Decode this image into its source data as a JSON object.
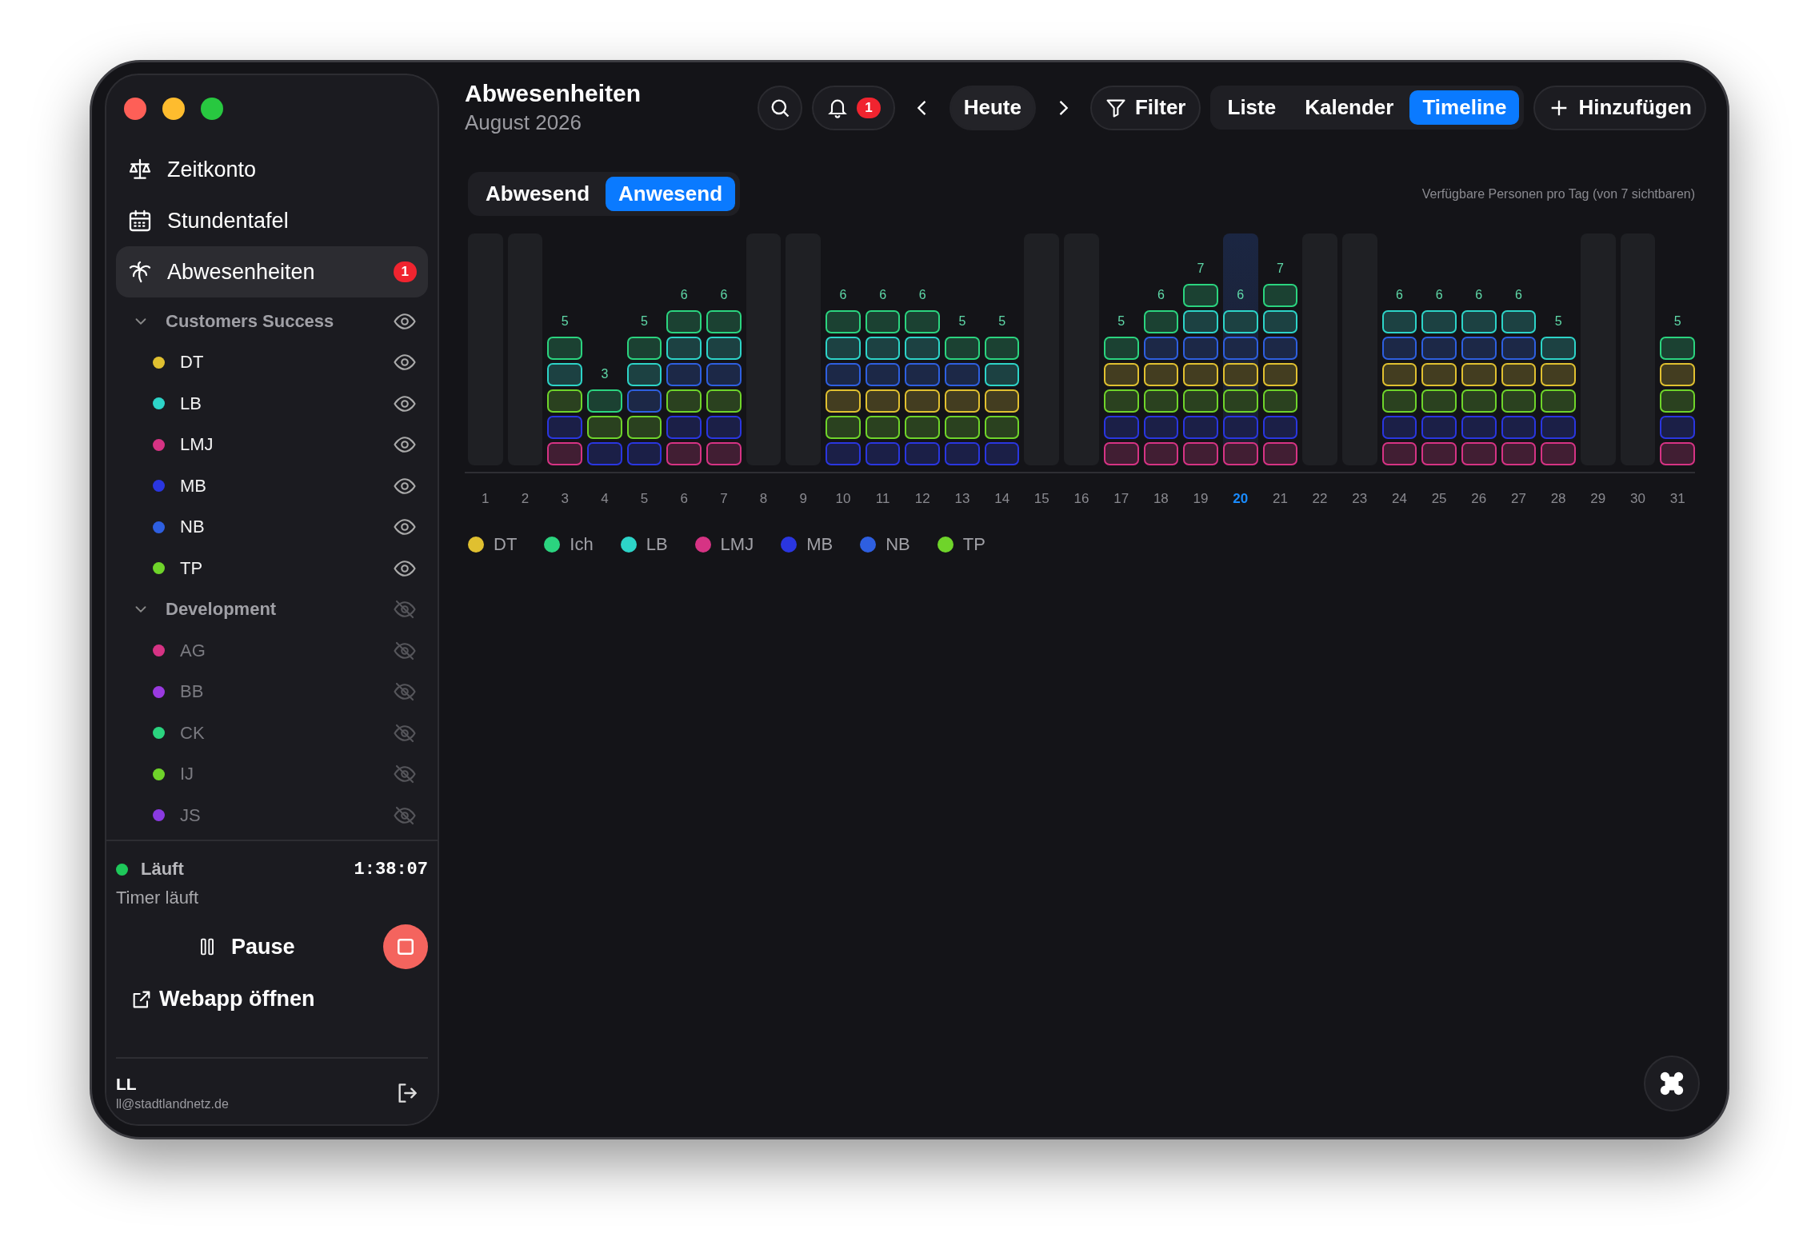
{
  "window": {
    "title": "Abwesenheiten",
    "subtitle": "August 2026"
  },
  "sidebar": {
    "nav": [
      {
        "kind": "scale",
        "label": "Zeitkonto",
        "selected": false
      },
      {
        "kind": "calendar",
        "label": "Stundentafel",
        "selected": false
      },
      {
        "kind": "palm",
        "label": "Abwesenheiten",
        "selected": true,
        "badge": "1"
      }
    ],
    "groups": [
      {
        "label": "Customers Success",
        "expanded": true,
        "visible": true,
        "children": [
          {
            "label": "DT",
            "color": "#e0c030",
            "visible": true
          },
          {
            "label": "LB",
            "color": "#2dd4c8",
            "visible": true
          },
          {
            "label": "LMJ",
            "color": "#d63384",
            "visible": true
          },
          {
            "label": "MB",
            "color": "#2a36e0",
            "visible": true
          },
          {
            "label": "NB",
            "color": "#2e5fe0",
            "visible": true
          },
          {
            "label": "TP",
            "color": "#6fd42a",
            "visible": true
          }
        ]
      },
      {
        "label": "Development",
        "expanded": true,
        "visible": false,
        "children": [
          {
            "label": "AG",
            "color": "#d63384",
            "visible": false
          },
          {
            "label": "BB",
            "color": "#9a3ae0",
            "visible": false
          },
          {
            "label": "CK",
            "color": "#2bd47f",
            "visible": false
          },
          {
            "label": "IJ",
            "color": "#6fd42a",
            "visible": false
          },
          {
            "label": "JS",
            "color": "#8a3ae0",
            "visible": false
          }
        ]
      }
    ],
    "timer": {
      "status": "Läuft",
      "running": true,
      "time": "1:38:07",
      "caption": "Timer läuft",
      "pause": "Pause"
    },
    "webapp": "Webapp öffnen",
    "user": {
      "name": "LL",
      "email": "ll@stadtlandnetz.de"
    }
  },
  "toolbar": {
    "notifications": "1",
    "today": "Heute",
    "filter": "Filter",
    "views": [
      {
        "label": "Liste",
        "selected": false
      },
      {
        "label": "Kalender",
        "selected": false
      },
      {
        "label": "Timeline",
        "selected": true
      }
    ],
    "add": "Hinzufügen"
  },
  "mode_tabs": [
    {
      "label": "Abwesend",
      "selected": false
    },
    {
      "label": "Anwesend",
      "selected": true
    }
  ],
  "caption": "Verfügbare Personen pro Tag (von 7 sichtbaren)",
  "days": [
    {
      "label": "1",
      "kind": "weekend",
      "today": false
    },
    {
      "label": "2",
      "kind": "weekend",
      "today": false
    },
    {
      "label": "3",
      "kind": "workday",
      "today": false,
      "count": "5",
      "blocks": [
        {
          "color": "#d63384"
        },
        {
          "color": "#2a36e0"
        },
        {
          "color": "#6fd42a"
        },
        {
          "color": "#2dd4c8"
        },
        {
          "color": "#2bd47f"
        }
      ]
    },
    {
      "label": "4",
      "kind": "workday",
      "today": false,
      "count": "3",
      "blocks": [
        {
          "color": "#2a36e0"
        },
        {
          "color": "#6fd42a"
        },
        {
          "color": "#2bd47f"
        }
      ]
    },
    {
      "label": "5",
      "kind": "workday",
      "today": false,
      "count": "5",
      "blocks": [
        {
          "color": "#2a36e0"
        },
        {
          "color": "#6fd42a"
        },
        {
          "color": "#2e5fe0"
        },
        {
          "color": "#2dd4c8"
        },
        {
          "color": "#2bd47f"
        }
      ]
    },
    {
      "label": "6",
      "kind": "workday",
      "today": false,
      "count": "6",
      "blocks": [
        {
          "color": "#d63384"
        },
        {
          "color": "#2a36e0"
        },
        {
          "color": "#6fd42a"
        },
        {
          "color": "#2e5fe0"
        },
        {
          "color": "#2dd4c8"
        },
        {
          "color": "#2bd47f"
        }
      ]
    },
    {
      "label": "7",
      "kind": "workday",
      "today": false,
      "count": "6",
      "blocks": [
        {
          "color": "#d63384"
        },
        {
          "color": "#2a36e0"
        },
        {
          "color": "#6fd42a"
        },
        {
          "color": "#2e5fe0"
        },
        {
          "color": "#2dd4c8"
        },
        {
          "color": "#2bd47f"
        }
      ]
    },
    {
      "label": "8",
      "kind": "weekend",
      "today": false
    },
    {
      "label": "9",
      "kind": "weekend",
      "today": false
    },
    {
      "label": "10",
      "kind": "workday",
      "today": false,
      "count": "6",
      "blocks": [
        {
          "color": "#2a36e0"
        },
        {
          "color": "#6fd42a"
        },
        {
          "color": "#e0c030"
        },
        {
          "color": "#2e5fe0"
        },
        {
          "color": "#2dd4c8"
        },
        {
          "color": "#2bd47f"
        }
      ]
    },
    {
      "label": "11",
      "kind": "workday",
      "today": false,
      "count": "6",
      "blocks": [
        {
          "color": "#2a36e0"
        },
        {
          "color": "#6fd42a"
        },
        {
          "color": "#e0c030"
        },
        {
          "color": "#2e5fe0"
        },
        {
          "color": "#2dd4c8"
        },
        {
          "color": "#2bd47f"
        }
      ]
    },
    {
      "label": "12",
      "kind": "workday",
      "today": false,
      "count": "6",
      "blocks": [
        {
          "color": "#2a36e0"
        },
        {
          "color": "#6fd42a"
        },
        {
          "color": "#e0c030"
        },
        {
          "color": "#2e5fe0"
        },
        {
          "color": "#2dd4c8"
        },
        {
          "color": "#2bd47f"
        }
      ]
    },
    {
      "label": "13",
      "kind": "workday",
      "today": false,
      "count": "5",
      "blocks": [
        {
          "color": "#2a36e0"
        },
        {
          "color": "#6fd42a"
        },
        {
          "color": "#e0c030"
        },
        {
          "color": "#2e5fe0"
        },
        {
          "color": "#2bd47f"
        }
      ]
    },
    {
      "label": "14",
      "kind": "workday",
      "today": false,
      "count": "5",
      "blocks": [
        {
          "color": "#2a36e0"
        },
        {
          "color": "#6fd42a"
        },
        {
          "color": "#e0c030"
        },
        {
          "color": "#2dd4c8"
        },
        {
          "color": "#2bd47f"
        }
      ]
    },
    {
      "label": "15",
      "kind": "weekend",
      "today": false
    },
    {
      "label": "16",
      "kind": "weekend",
      "today": false
    },
    {
      "label": "17",
      "kind": "workday",
      "today": false,
      "count": "5",
      "blocks": [
        {
          "color": "#d63384"
        },
        {
          "color": "#2a36e0"
        },
        {
          "color": "#6fd42a"
        },
        {
          "color": "#e0c030"
        },
        {
          "color": "#2bd47f"
        }
      ]
    },
    {
      "label": "18",
      "kind": "workday",
      "today": false,
      "count": "6",
      "blocks": [
        {
          "color": "#d63384"
        },
        {
          "color": "#2a36e0"
        },
        {
          "color": "#6fd42a"
        },
        {
          "color": "#e0c030"
        },
        {
          "color": "#2e5fe0"
        },
        {
          "color": "#2bd47f"
        }
      ]
    },
    {
      "label": "19",
      "kind": "workday",
      "today": false,
      "count": "7",
      "blocks": [
        {
          "color": "#d63384"
        },
        {
          "color": "#2a36e0"
        },
        {
          "color": "#6fd42a"
        },
        {
          "color": "#e0c030"
        },
        {
          "color": "#2e5fe0"
        },
        {
          "color": "#2dd4c8"
        },
        {
          "color": "#2bd47f"
        }
      ]
    },
    {
      "label": "20",
      "kind": "workday",
      "today": true,
      "count": "6",
      "blocks": [
        {
          "color": "#d63384"
        },
        {
          "color": "#2a36e0"
        },
        {
          "color": "#6fd42a"
        },
        {
          "color": "#e0c030"
        },
        {
          "color": "#2e5fe0"
        },
        {
          "color": "#2dd4c8"
        }
      ]
    },
    {
      "label": "21",
      "kind": "workday",
      "today": false,
      "count": "7",
      "blocks": [
        {
          "color": "#d63384"
        },
        {
          "color": "#2a36e0"
        },
        {
          "color": "#6fd42a"
        },
        {
          "color": "#e0c030"
        },
        {
          "color": "#2e5fe0"
        },
        {
          "color": "#2dd4c8"
        },
        {
          "color": "#2bd47f"
        }
      ]
    },
    {
      "label": "22",
      "kind": "weekend",
      "today": false
    },
    {
      "label": "23",
      "kind": "weekend",
      "today": false
    },
    {
      "label": "24",
      "kind": "workday",
      "today": false,
      "count": "6",
      "blocks": [
        {
          "color": "#d63384"
        },
        {
          "color": "#2a36e0"
        },
        {
          "color": "#6fd42a"
        },
        {
          "color": "#e0c030"
        },
        {
          "color": "#2e5fe0"
        },
        {
          "color": "#2dd4c8"
        }
      ]
    },
    {
      "label": "25",
      "kind": "workday",
      "today": false,
      "count": "6",
      "blocks": [
        {
          "color": "#d63384"
        },
        {
          "color": "#2a36e0"
        },
        {
          "color": "#6fd42a"
        },
        {
          "color": "#e0c030"
        },
        {
          "color": "#2e5fe0"
        },
        {
          "color": "#2dd4c8"
        }
      ]
    },
    {
      "label": "26",
      "kind": "workday",
      "today": false,
      "count": "6",
      "blocks": [
        {
          "color": "#d63384"
        },
        {
          "color": "#2a36e0"
        },
        {
          "color": "#6fd42a"
        },
        {
          "color": "#e0c030"
        },
        {
          "color": "#2e5fe0"
        },
        {
          "color": "#2dd4c8"
        }
      ]
    },
    {
      "label": "27",
      "kind": "workday",
      "today": false,
      "count": "6",
      "blocks": [
        {
          "color": "#d63384"
        },
        {
          "color": "#2a36e0"
        },
        {
          "color": "#6fd42a"
        },
        {
          "color": "#e0c030"
        },
        {
          "color": "#2e5fe0"
        },
        {
          "color": "#2dd4c8"
        }
      ]
    },
    {
      "label": "28",
      "kind": "workday",
      "today": false,
      "count": "5",
      "blocks": [
        {
          "color": "#d63384"
        },
        {
          "color": "#2a36e0"
        },
        {
          "color": "#6fd42a"
        },
        {
          "color": "#e0c030"
        },
        {
          "color": "#2dd4c8"
        }
      ]
    },
    {
      "label": "29",
      "kind": "weekend",
      "today": false
    },
    {
      "label": "30",
      "kind": "weekend",
      "today": false
    },
    {
      "label": "31",
      "kind": "workday",
      "today": false,
      "count": "5",
      "blocks": [
        {
          "color": "#d63384"
        },
        {
          "color": "#2a36e0"
        },
        {
          "color": "#6fd42a"
        },
        {
          "color": "#e0c030"
        },
        {
          "color": "#2bd47f"
        }
      ]
    }
  ],
  "legend": [
    {
      "label": "DT",
      "color": "#e0c030"
    },
    {
      "label": "Ich",
      "color": "#2bd47f"
    },
    {
      "label": "LB",
      "color": "#2dd4c8"
    },
    {
      "label": "LMJ",
      "color": "#d63384"
    },
    {
      "label": "MB",
      "color": "#2a36e0"
    },
    {
      "label": "NB",
      "color": "#2e5fe0"
    },
    {
      "label": "TP",
      "color": "#6fd42a"
    }
  ]
}
